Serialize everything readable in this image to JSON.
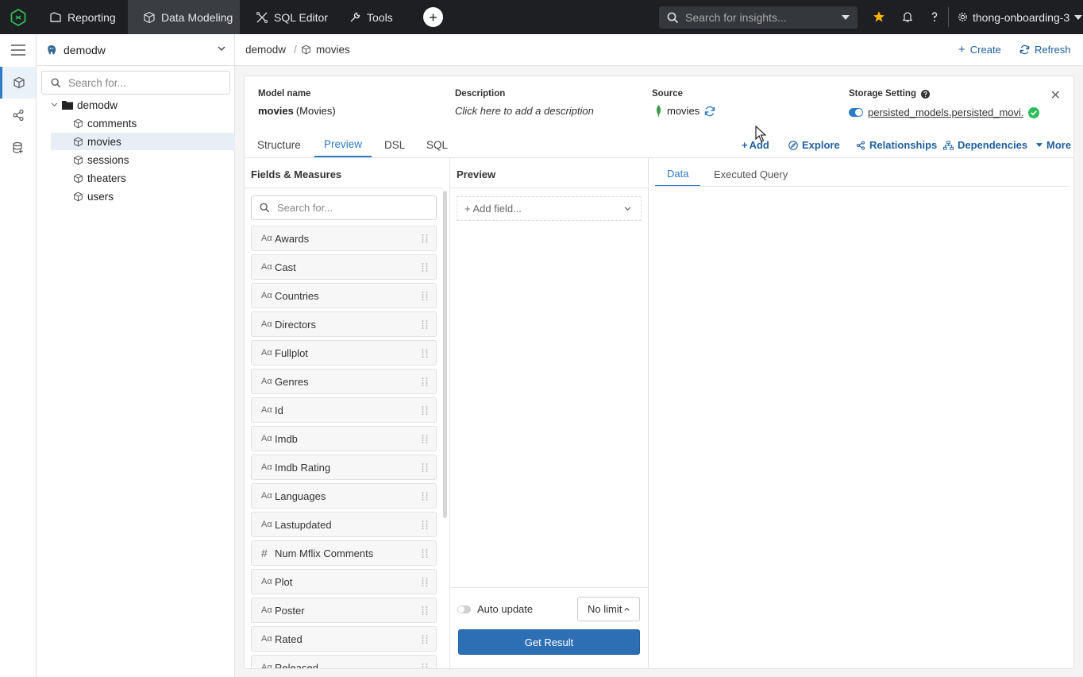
{
  "topnav": {
    "tabs": [
      {
        "label": "Reporting",
        "icon": "reporting-icon"
      },
      {
        "label": "Data Modeling",
        "icon": "cube-icon"
      },
      {
        "label": "SQL Editor",
        "icon": "sql-editor-icon"
      },
      {
        "label": "Tools",
        "icon": "wrench-icon"
      }
    ],
    "active_tab": "Data Modeling",
    "add_label": "+",
    "search_placeholder": "Search for insights...",
    "account": "thong-onboarding-3"
  },
  "sidebar": {
    "datasource": "demodw",
    "search_placeholder": "Search for...",
    "folder": "demodw",
    "models": [
      "comments",
      "movies",
      "sessions",
      "theaters",
      "users"
    ],
    "selected_model": "movies"
  },
  "breadcrumb": {
    "root": "demodw",
    "separator": "/",
    "current": "movies"
  },
  "header_actions": {
    "create": "Create",
    "refresh": "Refresh"
  },
  "model": {
    "name_label": "Model name",
    "name": "movies",
    "name_suffix": "(Movies)",
    "description_label": "Description",
    "description_placeholder": "Click here to add a description",
    "source_label": "Source",
    "source": "movies",
    "storage_label": "Storage Setting",
    "storage_value": "persisted_models.persisted_movi..."
  },
  "tabs": [
    "Structure",
    "Preview",
    "DSL",
    "SQL"
  ],
  "active_tab": "Preview",
  "actions": {
    "add": "Add",
    "explore": "Explore",
    "relationships": "Relationships",
    "dependencies": "Dependencies",
    "more": "More"
  },
  "fields_panel": {
    "title": "Fields & Measures",
    "search_placeholder": "Search for...",
    "fields": [
      {
        "type": "text",
        "name": "Awards"
      },
      {
        "type": "text",
        "name": "Cast"
      },
      {
        "type": "text",
        "name": "Countries"
      },
      {
        "type": "text",
        "name": "Directors"
      },
      {
        "type": "text",
        "name": "Fullplot"
      },
      {
        "type": "text",
        "name": "Genres"
      },
      {
        "type": "text",
        "name": "Id"
      },
      {
        "type": "text",
        "name": "Imdb"
      },
      {
        "type": "text",
        "name": "Imdb Rating"
      },
      {
        "type": "text",
        "name": "Languages"
      },
      {
        "type": "text",
        "name": "Lastupdated"
      },
      {
        "type": "number",
        "name": "Num Mflix Comments"
      },
      {
        "type": "text",
        "name": "Plot"
      },
      {
        "type": "text",
        "name": "Poster"
      },
      {
        "type": "text",
        "name": "Rated"
      },
      {
        "type": "text",
        "name": "Released"
      }
    ],
    "type_glyphs": {
      "text": "Aα",
      "number": "#"
    }
  },
  "preview_panel": {
    "title": "Preview",
    "add_field_placeholder": "+ Add field...",
    "auto_update_label": "Auto update",
    "limit": "No limit",
    "get_result": "Get Result"
  },
  "result_panel": {
    "tabs": [
      "Data",
      "Executed Query"
    ],
    "active_tab": "Data"
  },
  "colors": {
    "accent": "#2c7bc7",
    "topbar": "#1d1f22",
    "primary_button": "#2d6fb5",
    "success": "#2ebd59",
    "star": "#f5b400"
  }
}
